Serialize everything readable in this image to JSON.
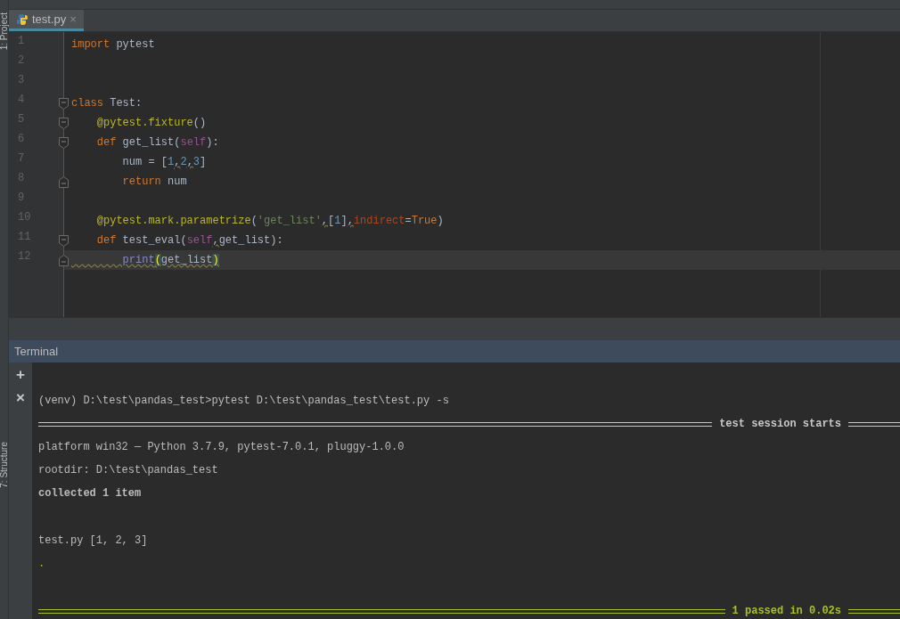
{
  "sidebar": {
    "labels": [
      {
        "text": "1: Project"
      },
      {
        "text": "7: Structure"
      }
    ]
  },
  "tabs": [
    {
      "label": "test.py",
      "selected": true,
      "close": "×"
    }
  ],
  "editor": {
    "lines": [
      {
        "n": "1",
        "current": false,
        "warn": false,
        "tokens": [
          {
            "t": "import",
            "kind": "keyword"
          },
          {
            "t": " pytest",
            "kind": "text"
          }
        ]
      },
      {
        "n": "2",
        "current": false
      },
      {
        "n": "3",
        "current": false
      },
      {
        "n": "4",
        "current": false,
        "warn": false,
        "fold_start": true,
        "tokens": [
          {
            "t": "class",
            "kind": "keyword"
          },
          {
            "t": " Test:",
            "kind": "text"
          }
        ]
      },
      {
        "n": "5",
        "current": false,
        "warn": false,
        "fold_start": true,
        "tokens": [
          {
            "t": "    @pytest.fixture",
            "kind": "decorator"
          },
          {
            "t": "()",
            "kind": "text"
          }
        ]
      },
      {
        "n": "6",
        "current": false,
        "warn": false,
        "fold_start": true,
        "tokens": [
          {
            "t": "    def",
            "kind": "keyword"
          },
          {
            "t": " get_list(",
            "kind": "text"
          },
          {
            "t": "self",
            "kind": "self"
          },
          {
            "t": "):",
            "kind": "text"
          }
        ]
      },
      {
        "n": "7",
        "current": false,
        "warn": false,
        "tokens": [
          {
            "t": "        num = [",
            "kind": "text"
          },
          {
            "t": "1",
            "kind": "number"
          },
          {
            "t": ",",
            "kind": "warn"
          },
          {
            "t": "2",
            "kind": "number"
          },
          {
            "t": ",",
            "kind": "warn"
          },
          {
            "t": "3",
            "kind": "number"
          },
          {
            "t": "]",
            "kind": "text"
          }
        ]
      },
      {
        "n": "8",
        "current": false,
        "warn": false,
        "fold_end": true,
        "tokens": [
          {
            "t": "        return",
            "kind": "keyword"
          },
          {
            "t": " num",
            "kind": "text"
          }
        ]
      },
      {
        "n": "9",
        "current": false
      },
      {
        "n": "10",
        "current": false,
        "warn": false,
        "tokens": [
          {
            "t": "    @pytest.mark.parametrize",
            "kind": "decorator"
          },
          {
            "t": "(",
            "kind": "text"
          },
          {
            "t": "'get_list'",
            "kind": "string"
          },
          {
            "t": ",",
            "kind": "warn"
          },
          {
            "t": "[",
            "kind": "text"
          },
          {
            "t": "1",
            "kind": "number"
          },
          {
            "t": "]",
            "kind": "text"
          },
          {
            "t": ",",
            "kind": "warn"
          },
          {
            "t": "indirect",
            "kind": "param"
          },
          {
            "t": "=",
            "kind": "text"
          },
          {
            "t": "True",
            "kind": "keyword"
          },
          {
            "t": ")",
            "kind": "text"
          }
        ]
      },
      {
        "n": "11",
        "current": false,
        "warn": false,
        "fold_start": true,
        "tokens": [
          {
            "t": "    def",
            "kind": "keyword"
          },
          {
            "t": " test_eval(",
            "kind": "text"
          },
          {
            "t": "self",
            "kind": "self"
          },
          {
            "t": ",",
            "kind": "warn"
          },
          {
            "t": "get_list):",
            "kind": "text"
          }
        ]
      },
      {
        "n": "12",
        "current": true,
        "warn": true,
        "fold_end": true,
        "tokens": [
          {
            "t": "        print",
            "kind": "builtin"
          },
          {
            "t": "(",
            "kind": "match"
          },
          {
            "t": "get_list",
            "kind": "text"
          },
          {
            "t": ")",
            "kind": "match"
          }
        ]
      }
    ]
  },
  "terminal": {
    "title": "Terminal",
    "tools": [
      {
        "icon": "+"
      },
      {
        "icon": "×"
      }
    ],
    "lines": [
      {
        "kind": "command",
        "text": "(venv) D:\\test\\pandas_test>pytest D:\\test\\pandas_test\\test.py -s"
      },
      {
        "kind": "rule",
        "text": "test session starts",
        "passed": false
      },
      {
        "kind": "output",
        "text": "platform win32 — Python 3.7.9, pytest-7.0.1, pluggy-1.0.0"
      },
      {
        "kind": "output",
        "text": "rootdir: D:\\test\\pandas_test"
      },
      {
        "kind": "bold",
        "text": "collected 1 item"
      },
      {
        "kind": "output",
        "text": "test.py [1, 2, 3]",
        "after_blank": true
      },
      {
        "kind": "progress",
        "text": "."
      },
      {
        "kind": "rule",
        "text": "1 passed in 0.02s",
        "passed": true,
        "after_blank": true
      }
    ]
  }
}
